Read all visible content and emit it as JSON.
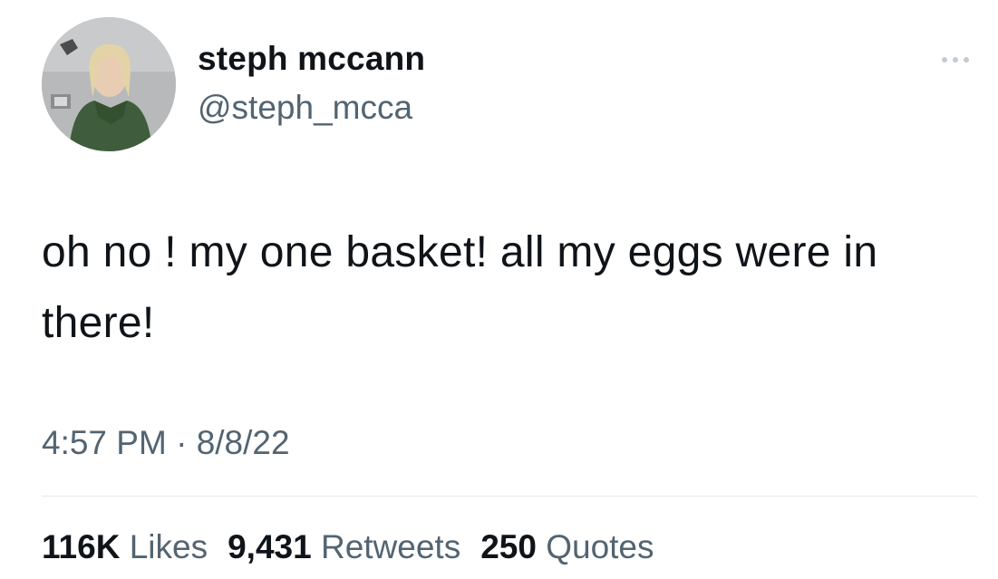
{
  "author": {
    "display_name": "steph mccann",
    "handle": "@steph_mcca",
    "avatar": "profile-photo"
  },
  "tweet": {
    "text": "oh no ! my one basket! all my eggs were in there!",
    "time": "4:57 PM",
    "separator": "·",
    "date": "8/8/22"
  },
  "stats": {
    "likes_count": "116K",
    "likes_label": "Likes",
    "retweets_count": "9,431",
    "retweets_label": "Retweets",
    "quotes_count": "250",
    "quotes_label": "Quotes"
  },
  "icons": {
    "more": "more-options-icon"
  },
  "colors": {
    "primary_text": "#0f1419",
    "secondary_text": "#536471",
    "divider": "#e3e7ea",
    "background": "#ffffff"
  }
}
